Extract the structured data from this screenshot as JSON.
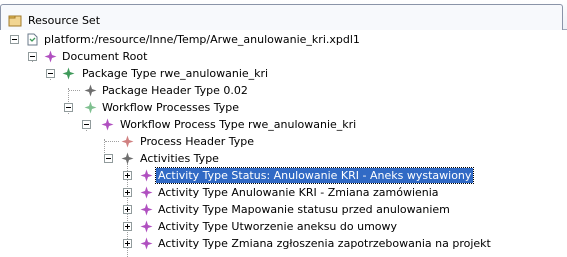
{
  "panel": {
    "title": "Resource Set",
    "title_icon": "resource-set-icon"
  },
  "tree": {
    "nodes": [
      {
        "label": "platform:/resource/Inne/Temp/Arwe_anulowanie_kri.xpdl1",
        "icon": "file-icon",
        "expanded": true
      },
      {
        "label": "Document Root",
        "icon": "diamond-icon",
        "expanded": true
      },
      {
        "label": "Package Type rwe_anulowanie_kri",
        "icon": "diamond-icon",
        "expanded": true
      },
      {
        "label": "Package Header Type 0.02",
        "icon": "diamond-icon"
      },
      {
        "label": "Workflow Processes Type",
        "icon": "diamond-icon",
        "expanded": true
      },
      {
        "label": "Workflow Process Type rwe_anulowanie_kri",
        "icon": "diamond-icon",
        "expanded": true
      },
      {
        "label": "Process Header Type",
        "icon": "diamond-icon"
      },
      {
        "label": "Activities Type",
        "icon": "diamond-icon",
        "expanded": true
      },
      {
        "label": "Activity Type Status: Anulowanie KRI - Aneks wystawiony",
        "icon": "diamond-icon",
        "expanded": false,
        "selected": true
      },
      {
        "label": "Activity Type Anulowanie KRI - Zmiana zamówienia",
        "icon": "diamond-icon",
        "expanded": false
      },
      {
        "label": "Activity Type Mapowanie statusu przed anulowaniem",
        "icon": "diamond-icon",
        "expanded": false
      },
      {
        "label": "Activity Type Utworzenie aneksu do umowy",
        "icon": "diamond-icon",
        "expanded": false
      },
      {
        "label": "Activity Type Zmiana zgłoszenia zapotrzebowania na projekt",
        "icon": "diamond-icon",
        "expanded": false
      }
    ]
  },
  "colors": {
    "selection": "#316ac5",
    "diamond_green": "#3f9a5a",
    "diamond_gray": "#6e6e6e",
    "diamond_red": "#c04040",
    "diamond_purple": "#b050c0"
  }
}
